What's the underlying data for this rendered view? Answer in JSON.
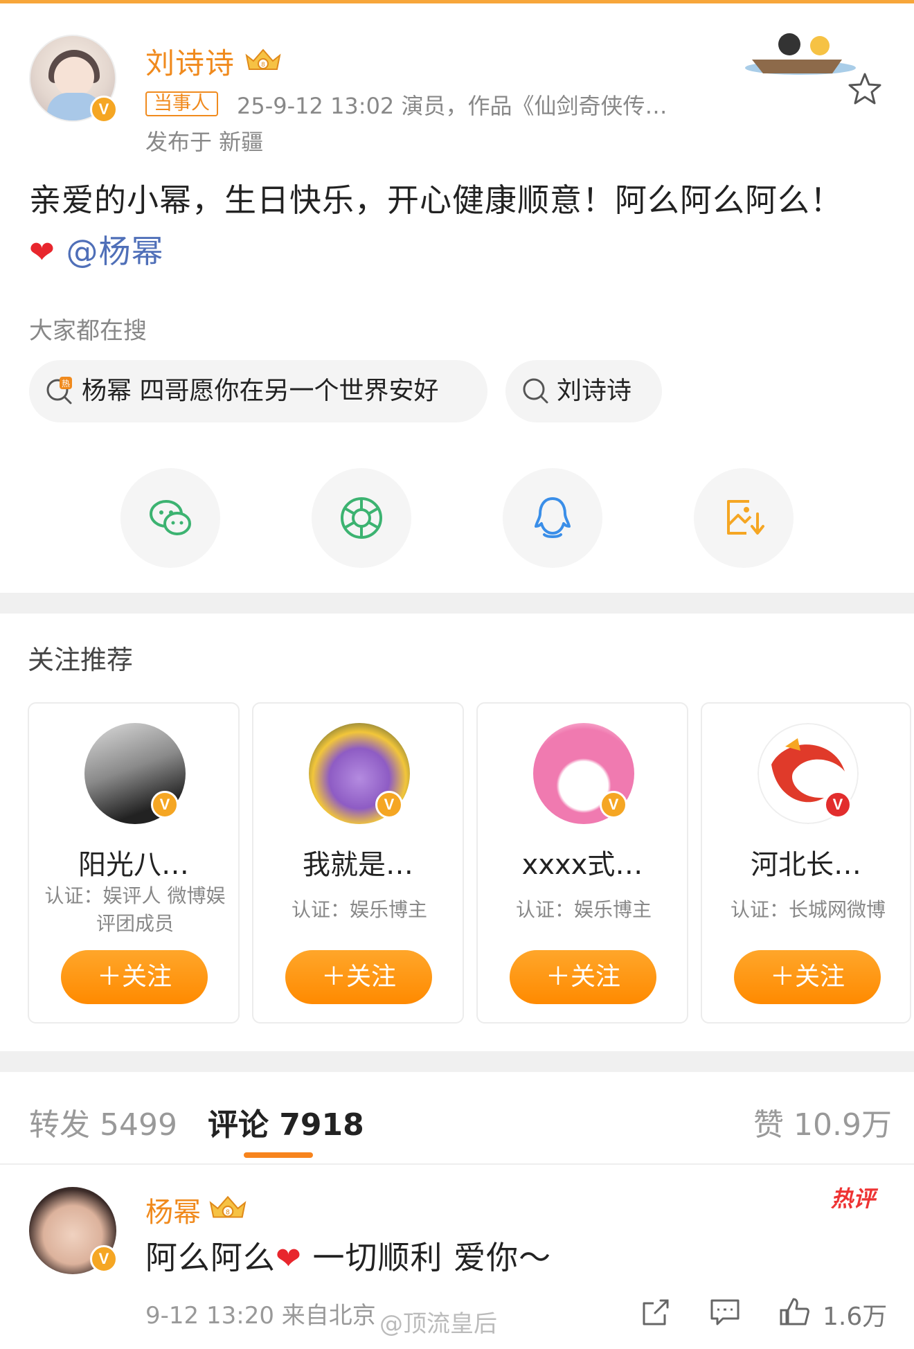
{
  "post": {
    "author": "刘诗诗",
    "tag": "当事人",
    "meta": "25-9-12 13:02  演员，作品《仙剑奇侠传…",
    "location": "发布于 新疆",
    "text_main": "亲爱的小幂，生日快乐，开心健康顺意！阿么阿么阿么！",
    "heart": "❤",
    "mention": "@杨幂"
  },
  "search": {
    "label": "大家都在搜",
    "chips": [
      "杨幂 四哥愿你在另一个世界安好",
      "刘诗诗"
    ]
  },
  "share": {
    "icons": [
      "wechat-icon",
      "moments-icon",
      "qq-icon",
      "save-image-icon"
    ]
  },
  "recommend": {
    "title": "关注推荐",
    "cards": [
      {
        "name": "阳光八…",
        "cert": "认证：娱评人 微博娱评团成员",
        "follow": "＋关注"
      },
      {
        "name": "我就是…",
        "cert": "认证：娱乐博主",
        "follow": "＋关注"
      },
      {
        "name": "xxxx式…",
        "cert": "认证：娱乐博主",
        "follow": "＋关注"
      },
      {
        "name": "河北长…",
        "cert": "认证：长城网微博",
        "follow": "＋关注"
      }
    ]
  },
  "tabs": {
    "repost": "转发 5499",
    "comment": "评论 7918",
    "like": "赞 10.9万"
  },
  "comment": {
    "author": "杨幂",
    "hot": "热评",
    "text_a": "阿么阿么",
    "heart": "❤",
    "text_b": " 一切顺利 爱你～",
    "meta": "9-12 13:20 来自北京",
    "watermark": "@顶流皇后",
    "likes": "1.6万"
  },
  "colors": {
    "accent": "#f08a1d",
    "follow_button": "#ff9a1a",
    "mention": "#4f6fb8",
    "heart": "#e8262d"
  }
}
